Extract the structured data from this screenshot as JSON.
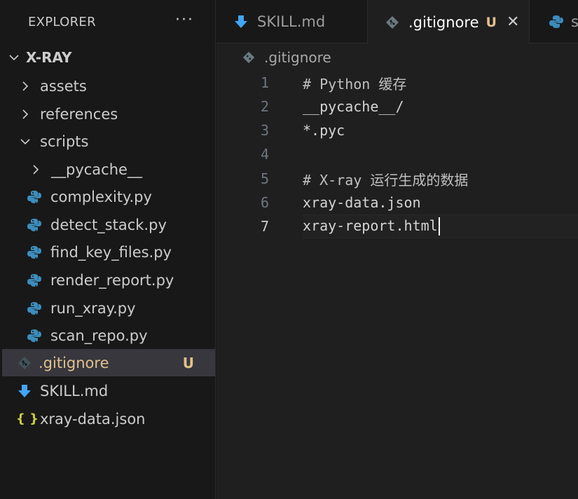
{
  "explorer": {
    "title": "EXPLORER",
    "more": "···",
    "root": "X-RAY",
    "items": [
      {
        "label": "assets",
        "type": "folder",
        "expanded": false
      },
      {
        "label": "references",
        "type": "folder",
        "expanded": false
      },
      {
        "label": "scripts",
        "type": "folder",
        "expanded": true
      },
      {
        "label": "__pycache__",
        "type": "folder",
        "expanded": false
      },
      {
        "label": "complexity.py",
        "type": "python"
      },
      {
        "label": "detect_stack.py",
        "type": "python"
      },
      {
        "label": "find_key_files.py",
        "type": "python"
      },
      {
        "label": "render_report.py",
        "type": "python"
      },
      {
        "label": "run_xray.py",
        "type": "python"
      },
      {
        "label": "scan_repo.py",
        "type": "python"
      },
      {
        "label": ".gitignore",
        "type": "git",
        "badge": "U",
        "selected": true
      },
      {
        "label": "SKILL.md",
        "type": "markdown"
      },
      {
        "label": "xray-data.json",
        "type": "json",
        "icon_text": "{ }"
      }
    ]
  },
  "tabs": [
    {
      "label": "SKILL.md",
      "icon": "markdown-icon"
    },
    {
      "label": ".gitignore",
      "badge": "U",
      "close": "✕",
      "active": true,
      "icon": "git-icon"
    },
    {
      "label": "s",
      "icon": "python-icon"
    }
  ],
  "breadcrumb": ".gitignore",
  "editor": {
    "lines": [
      {
        "n": "1",
        "text": "# Python 缓存",
        "comment": true
      },
      {
        "n": "2",
        "text": "__pycache__/"
      },
      {
        "n": "3",
        "text": "*.pyc"
      },
      {
        "n": "4",
        "text": ""
      },
      {
        "n": "5",
        "text": "# X-ray 运行生成的数据",
        "comment": true
      },
      {
        "n": "6",
        "text": "xray-data.json"
      },
      {
        "n": "7",
        "text": "xray-report.html",
        "current": true
      }
    ]
  },
  "colors": {
    "background": "#181818",
    "editor_background": "#1f1f1f",
    "selection": "#37373d",
    "untracked": "#e2c08d",
    "python_blue": "#3c8dbc",
    "markdown_blue": "#42a5f5",
    "json_yellow": "#cbcb41"
  }
}
